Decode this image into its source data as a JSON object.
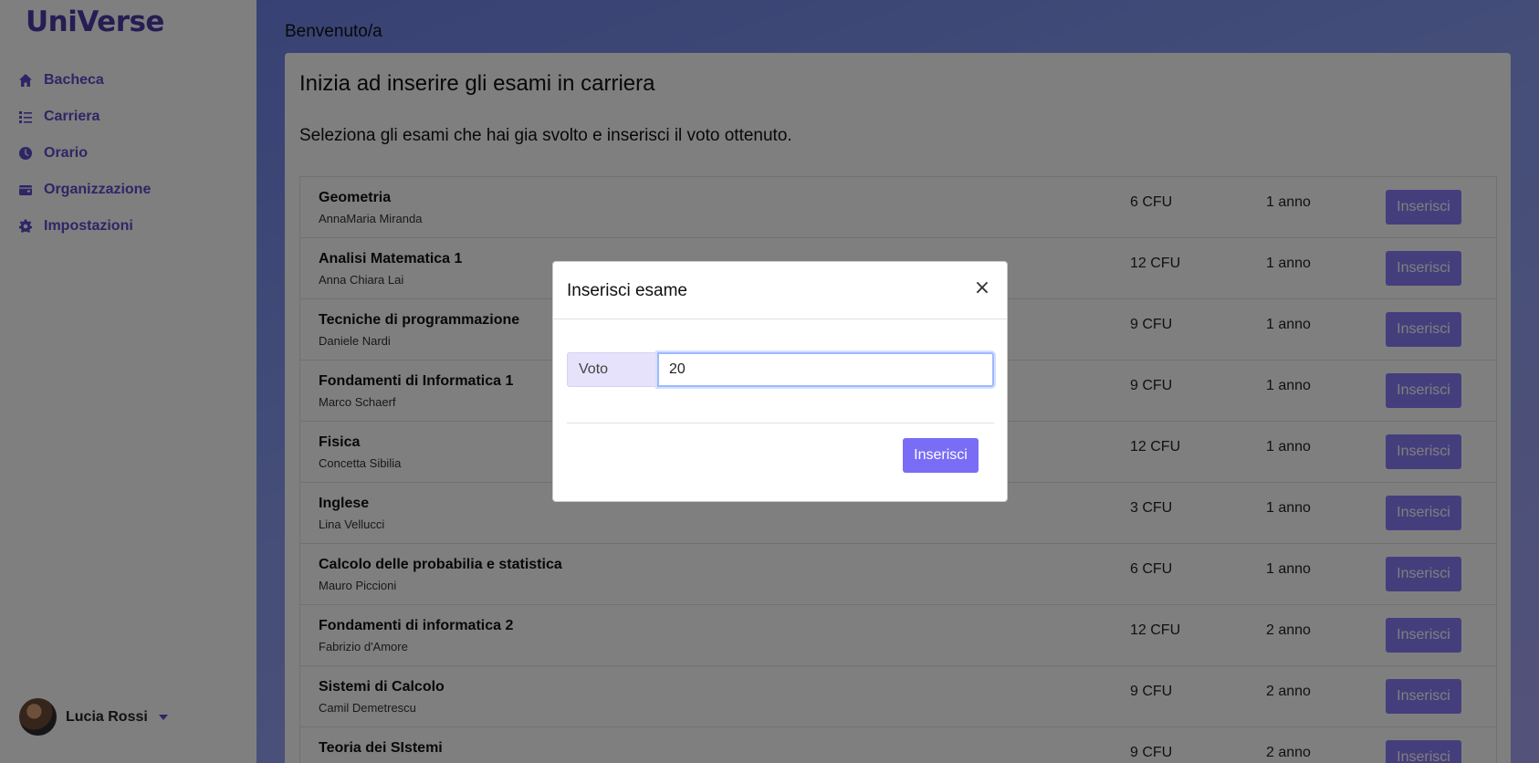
{
  "app": {
    "brand": "UniVerse"
  },
  "sidebar": {
    "items": [
      {
        "label": "Bacheca",
        "icon": "home-icon"
      },
      {
        "label": "Carriera",
        "icon": "list-icon"
      },
      {
        "label": "Orario",
        "icon": "clock-icon"
      },
      {
        "label": "Organizzazione",
        "icon": "wallet-icon"
      },
      {
        "label": "Impostazioni",
        "icon": "gear-icon"
      }
    ],
    "user": {
      "name": "Lucia Rossi"
    }
  },
  "main": {
    "welcome": "Benvenuto/a",
    "title": "Inizia ad inserire gli esami in carriera",
    "subtitle": "Seleziona gli esami che hai gia svolto e inserisci il voto ottenuto.",
    "exams": [
      {
        "name": "Geometria",
        "professor": "AnnaMaria Miranda",
        "cfu": "6 CFU",
        "anno": "1 anno",
        "button": "Inserisci"
      },
      {
        "name": "Analisi Matematica 1",
        "professor": "Anna Chiara Lai",
        "cfu": "12 CFU",
        "anno": "1 anno",
        "button": "Inserisci"
      },
      {
        "name": "Tecniche di programmazione",
        "professor": "Daniele Nardi",
        "cfu": "9 CFU",
        "anno": "1 anno",
        "button": "Inserisci"
      },
      {
        "name": "Fondamenti di Informatica 1",
        "professor": "Marco Schaerf",
        "cfu": "9 CFU",
        "anno": "1 anno",
        "button": "Inserisci"
      },
      {
        "name": "Fisica",
        "professor": "Concetta Sibilia",
        "cfu": "12 CFU",
        "anno": "1 anno",
        "button": "Inserisci"
      },
      {
        "name": "Inglese",
        "professor": "Lina Vellucci",
        "cfu": "3 CFU",
        "anno": "1 anno",
        "button": "Inserisci"
      },
      {
        "name": "Calcolo delle probabilia e statistica",
        "professor": "Mauro Piccioni",
        "cfu": "6 CFU",
        "anno": "1 anno",
        "button": "Inserisci"
      },
      {
        "name": "Fondamenti di informatica 2",
        "professor": "Fabrizio d'Amore",
        "cfu": "12 CFU",
        "anno": "2 anno",
        "button": "Inserisci"
      },
      {
        "name": "Sistemi di Calcolo",
        "professor": "Camil Demetrescu",
        "cfu": "9 CFU",
        "anno": "2 anno",
        "button": "Inserisci"
      },
      {
        "name": "Teoria dei SIstemi",
        "professor": "",
        "cfu": "9 CFU",
        "anno": "2 anno",
        "button": "Inserisci"
      }
    ]
  },
  "modal": {
    "title": "Inserisci esame",
    "close": "×",
    "field_label": "Voto",
    "field_value": "20",
    "submit": "Inserisci"
  },
  "colors": {
    "accent": "#5b4ccc",
    "button": "#8a7cf9",
    "brand": "#4a3aa8"
  }
}
